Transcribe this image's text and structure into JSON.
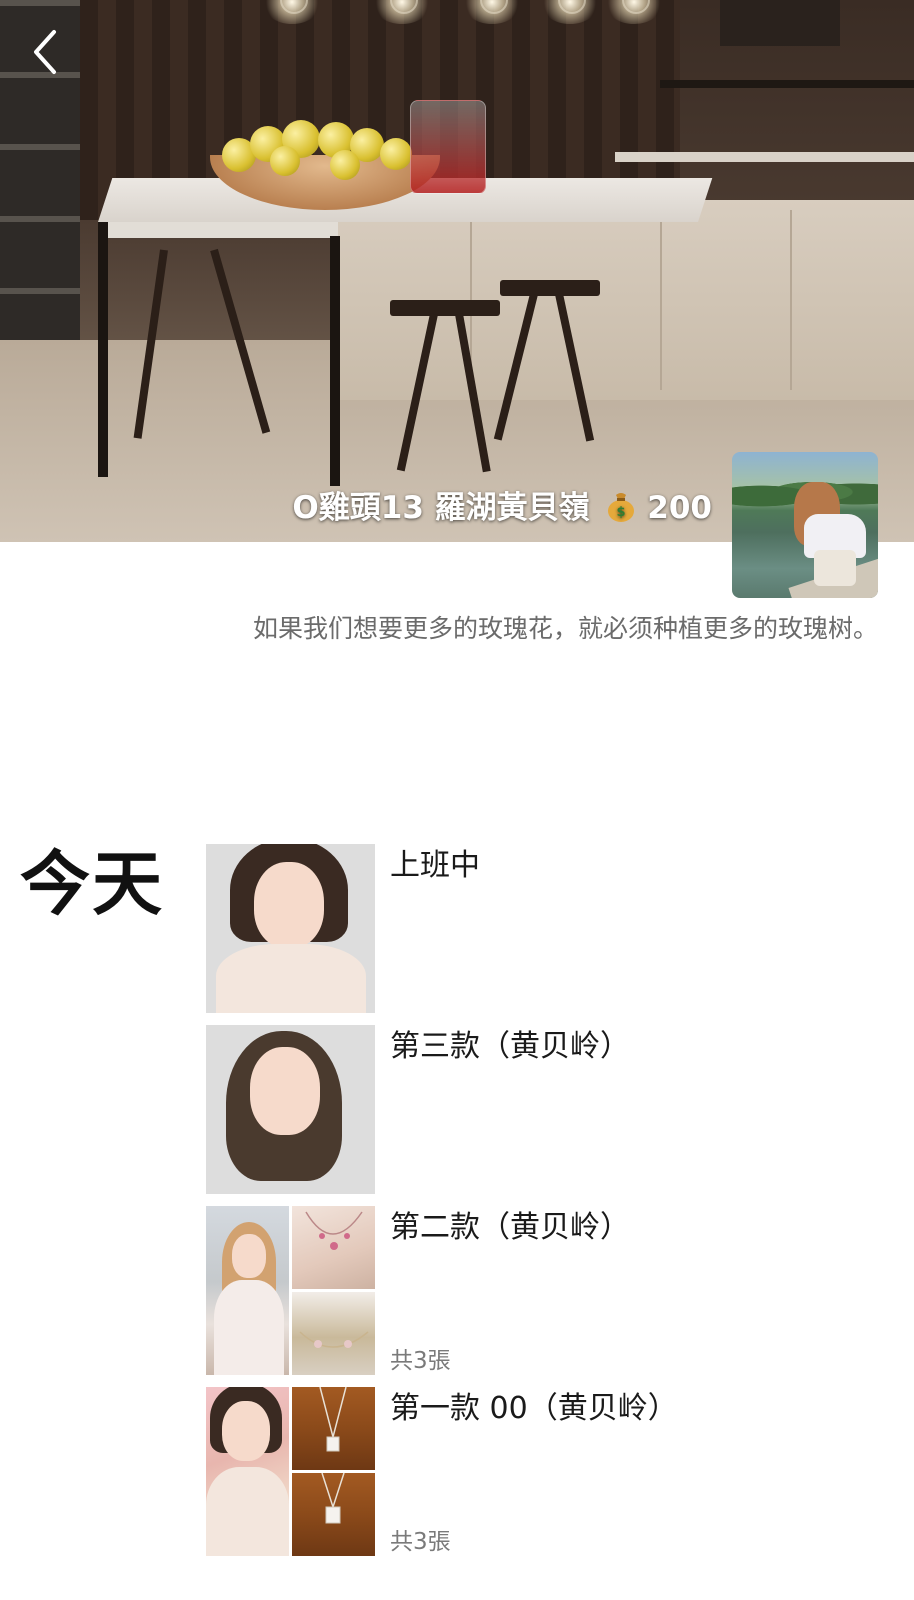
{
  "header": {
    "back_label": "back",
    "owner_name": "O雞頭13 羅湖黃貝嶺",
    "money_icon": "money-bag-icon",
    "money_amount": "200"
  },
  "profile": {
    "signature": "如果我们想要更多的玫瑰花，就必须种植更多的玫瑰树。"
  },
  "timeline": {
    "day_label": "今天",
    "posts": [
      {
        "caption": "上班中",
        "count": ""
      },
      {
        "caption": "第三款（黄贝岭）",
        "count": ""
      },
      {
        "caption": "第二款（黄贝岭）",
        "count": "共3張"
      },
      {
        "caption": "第一款 00（黄贝岭）",
        "count": "共3張"
      }
    ]
  }
}
